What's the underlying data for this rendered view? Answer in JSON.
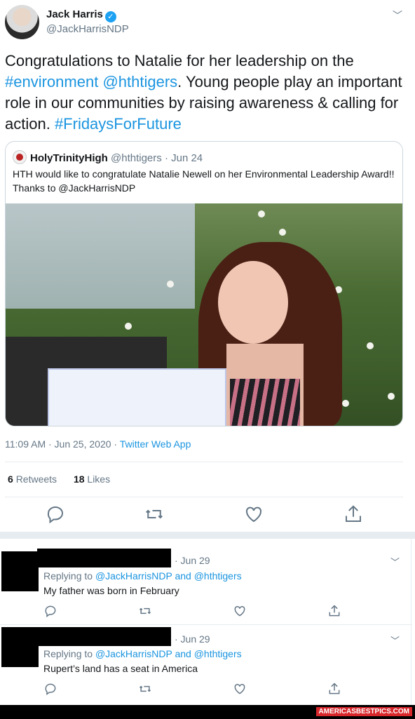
{
  "tweet": {
    "author_name": "Jack Harris",
    "verified_glyph": "✓",
    "handle": "@JackHarrisNDP",
    "chevron_glyph": "﹀",
    "text_parts": [
      "Congratulations to Natalie for her leadership on the ",
      "#environment",
      " ",
      "@hthtigers",
      ". Young people play an important role in our communities by raising awareness & calling for action. ",
      "#FridaysForFuture"
    ],
    "quote": {
      "name": "HolyTrinityHigh",
      "handle": "@hthtigers",
      "date": "· Jun 24",
      "text": "HTH would like to congratulate Natalie Newell on her Environmental Leadership Award!! Thanks to @JackHarrisNDP"
    },
    "timestamp": "11:09 AM · Jun 25, 2020 · ",
    "source": "Twitter Web App",
    "retweets_count": "6",
    "retweets_label": "Retweets",
    "likes_count": "18",
    "likes_label": "Likes"
  },
  "replies": [
    {
      "date": "· Jun 29",
      "replying_prefix": "Replying to ",
      "replying_to": "@JackHarrisNDP and @hthtigers",
      "text": "My father was born in February"
    },
    {
      "date": "· Jun 29",
      "replying_prefix": "Replying to ",
      "replying_to": "@JackHarrisNDP and @hthtigers",
      "text": "Rupert’s land has a seat in America"
    }
  ],
  "footer": {
    "watermark": "AMERICASBESTPICS.COM"
  },
  "colors": {
    "link": "#1b95e0",
    "verified": "#1da1f2",
    "muted": "#657786"
  },
  "icons": [
    "reply-icon",
    "retweet-icon",
    "like-icon",
    "share-icon",
    "chevron-down-icon",
    "verified-icon"
  ]
}
